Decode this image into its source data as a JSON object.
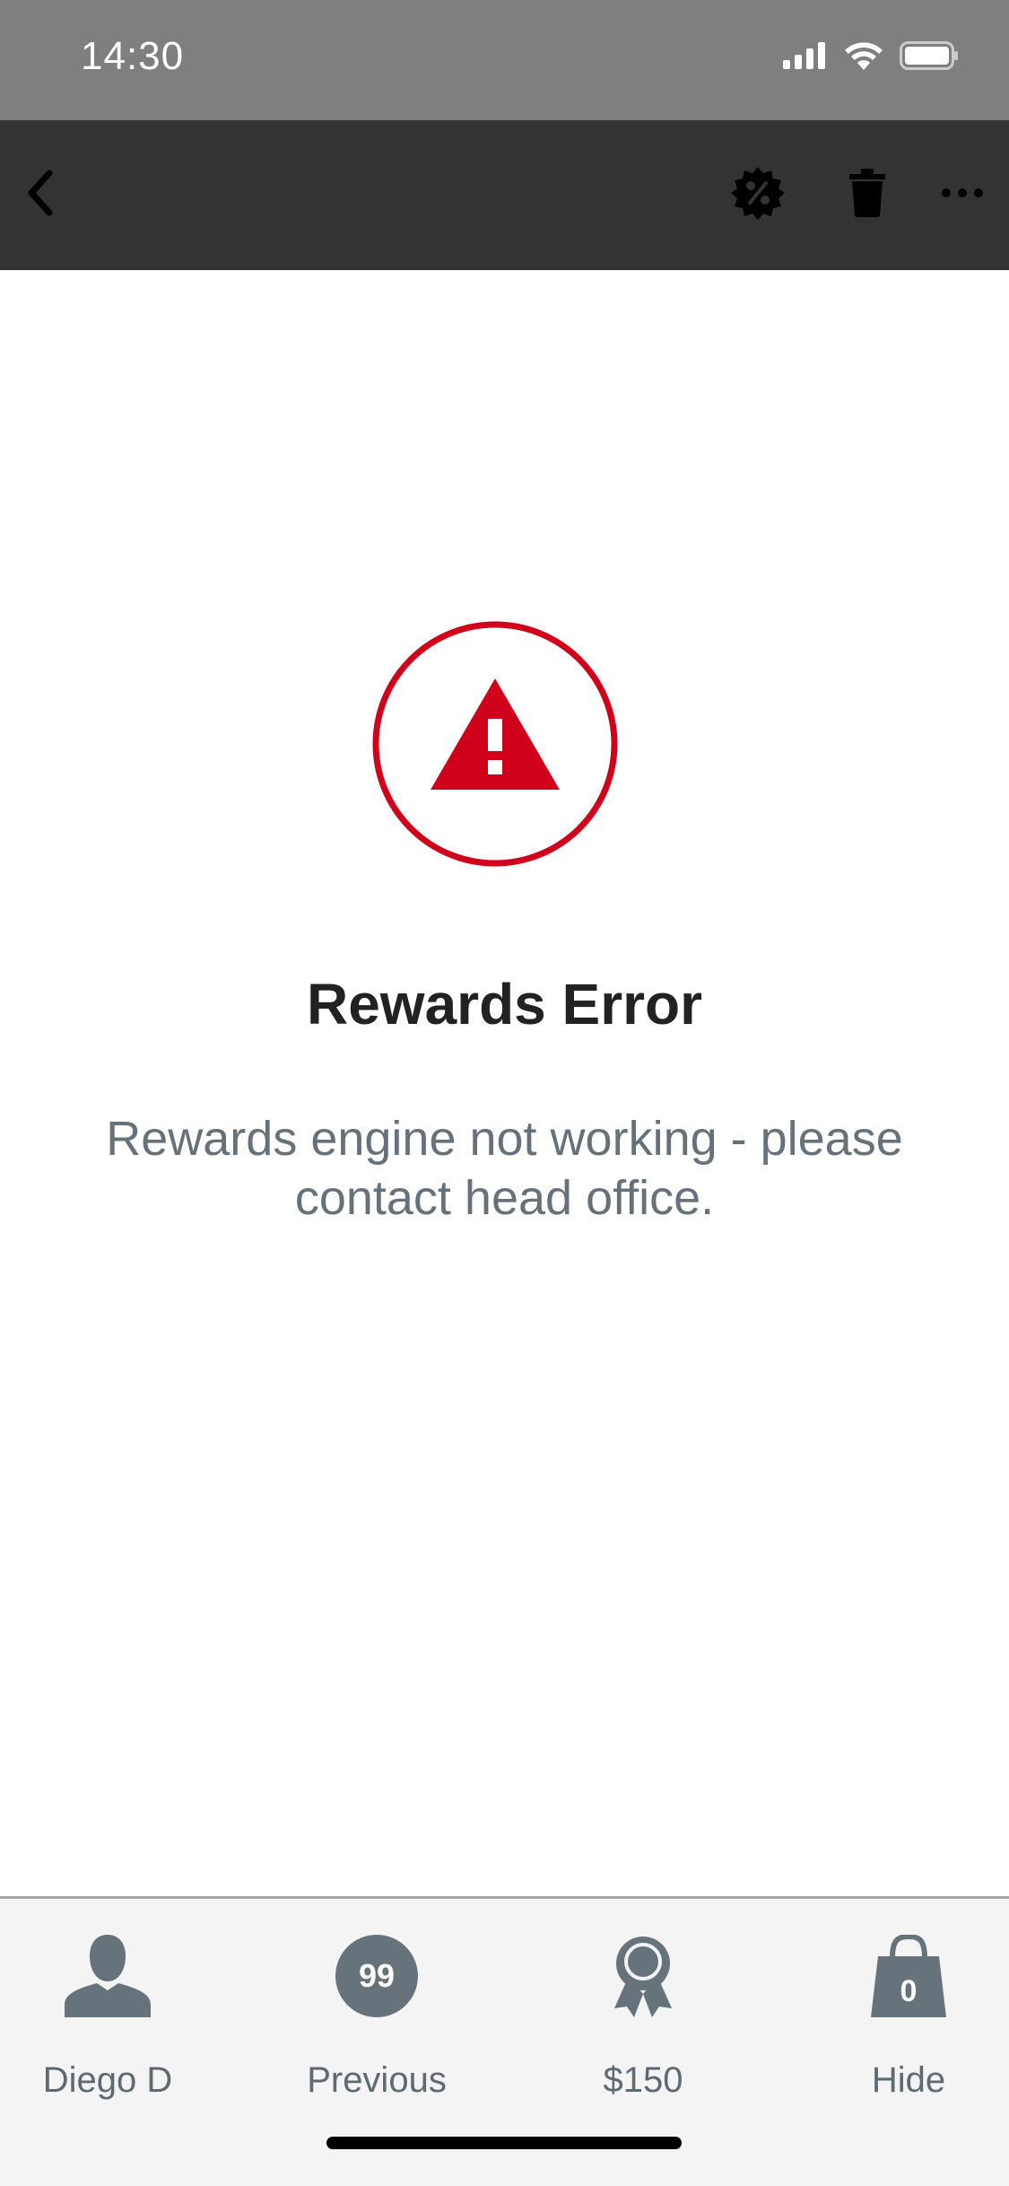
{
  "status_bar": {
    "time": "14:30",
    "icons": [
      "signal-icon",
      "wifi-icon",
      "battery-icon"
    ]
  },
  "toolbar": {
    "icons": [
      "back-chevron-icon",
      "discount-badge-icon",
      "trash-icon",
      "more-icon"
    ]
  },
  "error": {
    "icon": "warning-triangle-icon",
    "title": "Rewards Error",
    "message": "Rewards engine not working - please contact head office.",
    "accent_color": "#d0021b"
  },
  "tabbar": {
    "user": {
      "label": "Diego D",
      "icon": "person-icon"
    },
    "previous": {
      "label": "Previous",
      "badge": "99"
    },
    "rewards": {
      "label": "$150",
      "icon": "award-ribbon-icon"
    },
    "hide": {
      "label": "Hide",
      "count": "0",
      "icon": "shopping-bag-icon"
    }
  }
}
